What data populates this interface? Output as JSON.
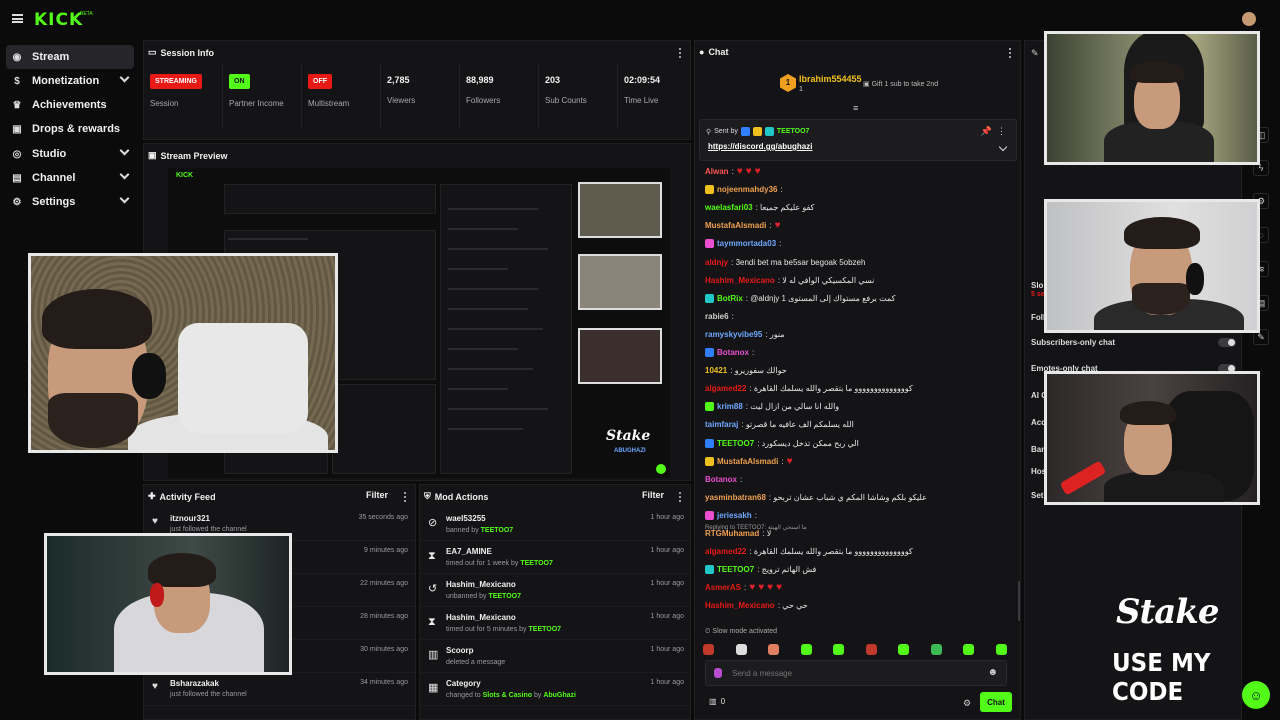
{
  "app": {
    "brand": "KICK",
    "brand_sup": "BETA",
    "accent": "#53fc18"
  },
  "sidebar": {
    "items": [
      {
        "label": "Stream",
        "icon": "broadcast-icon",
        "glyph": "((•))"
      },
      {
        "label": "Monetization",
        "icon": "dollar-icon",
        "glyph": "$"
      },
      {
        "label": "Achievements",
        "icon": "trophy-icon",
        "glyph": "🏆"
      },
      {
        "label": "Drops & rewards",
        "icon": "gift-icon",
        "glyph": "▣"
      },
      {
        "label": "Studio",
        "icon": "studio-icon",
        "glyph": "◎"
      },
      {
        "label": "Channel",
        "icon": "channel-icon",
        "glyph": "▤"
      },
      {
        "label": "Settings",
        "icon": "gear-icon",
        "glyph": "⚙"
      }
    ]
  },
  "session": {
    "title": "Session Info",
    "stats": [
      {
        "value": "STREAMING",
        "label": "Session",
        "badge_color": "#e91916"
      },
      {
        "value": "ON",
        "label": "Partner Income",
        "badge_color": "#53fc18"
      },
      {
        "value": "OFF",
        "label": "Multistream",
        "badge_color": "#e91916"
      },
      {
        "value": "2,785",
        "label": "Viewers"
      },
      {
        "value": "88,989",
        "label": "Followers"
      },
      {
        "value": "203",
        "label": "Sub Counts"
      },
      {
        "value": "02:09:54",
        "label": "Time Live"
      }
    ]
  },
  "preview": {
    "title": "Stream Preview",
    "overlay_brand": "Stake",
    "overlay_sub": "ABUGHAZI"
  },
  "activity": {
    "title": "Activity Feed",
    "filter": "Filter",
    "rows": [
      {
        "name": "itznour321",
        "sub": "just followed the channel",
        "time": "35 seconds ago"
      },
      {
        "name": "",
        "sub": "",
        "time": "9 minutes ago"
      },
      {
        "name": "",
        "sub": "",
        "time": "22 minutes ago"
      },
      {
        "name": "",
        "sub": "",
        "time": "28 minutes ago"
      },
      {
        "name": "",
        "sub": "",
        "time": "30 minutes ago"
      },
      {
        "name": "Bsharazakak",
        "sub": "just followed the channel",
        "time": "34 minutes ago"
      }
    ]
  },
  "mod": {
    "title": "Mod Actions",
    "filter": "Filter",
    "rows": [
      {
        "icon": "ban-icon",
        "glyph": "⊘",
        "name": "wael53255",
        "action": "banned by",
        "by": "TEETOO7",
        "time": "1 hour ago"
      },
      {
        "icon": "hourglass-icon",
        "glyph": "⧗",
        "name": "EA7_AMINE",
        "action": "timed out for 1 week by",
        "by": "TEETOO7",
        "time": "1 hour ago"
      },
      {
        "icon": "undo-icon",
        "glyph": "↺",
        "name": "Hashim_Mexicano",
        "action": "unbanned by",
        "by": "TEETOO7",
        "time": "1 hour ago"
      },
      {
        "icon": "hourglass-icon",
        "glyph": "⧗",
        "name": "Hashim_Mexicano",
        "action": "timed out for 5 minutes by",
        "by": "TEETOO7",
        "time": "1 hour ago"
      },
      {
        "icon": "trash-icon",
        "glyph": "🗑",
        "name": "Scoorp",
        "action": "deleted a message",
        "by": "",
        "time": "1 hour ago"
      },
      {
        "icon": "category-icon",
        "glyph": "▦",
        "name": "Category",
        "action": "changed to",
        "by": "Slots & Casino",
        "action2": "by",
        "by2": "AbuGhazi",
        "time": "1 hour ago"
      }
    ]
  },
  "chat": {
    "title": "Chat",
    "gifter": "Ibrahim554455",
    "gifter_rank": "1",
    "gift_count": "1",
    "gift_text": "Gift 1 sub to take 2nd",
    "pinned_by": "Sent by",
    "pinned_user": "TEETOO7",
    "pinned_link": "https://discord.gg/abughazi",
    "messages": [
      {
        "user": "Alwan",
        "color": "#f55",
        "text": ":",
        "hearts": 3
      },
      {
        "user": "nojeenmahdy36",
        "color": "#f0a050",
        "text": ":"
      },
      {
        "user": "waelasfari03",
        "color": "#53fc18",
        "text": ": كفو عليكم جميعا"
      },
      {
        "user": "MustafaAlsmadi",
        "color": "#f0a050",
        "text": ":",
        "hearts": 1
      },
      {
        "user": "taymmortada03",
        "color": "#6fa8ff",
        "text": ":"
      },
      {
        "user": "aldnjy",
        "color": "#e91916",
        "text": ": 3endi bet ma be5sar begoak 5obzeh"
      },
      {
        "user": "Hashim_Mexicano",
        "color": "#e91916",
        "text": ": نسي المكسيكي الوافي له لا"
      },
      {
        "user": "BotRix",
        "color": "#53fc18",
        "text": ": @aldnjy كمت برفع مستواك إلى المستوى 1"
      },
      {
        "user": "rabie6",
        "color": "#ccc",
        "text": ":"
      },
      {
        "user": "ramyskyvibe95",
        "color": "#6fa8ff",
        "text": ": منور"
      },
      {
        "user": "Botanox",
        "color": "#e94fd0",
        "text": ":"
      },
      {
        "user": "10421",
        "color": "#f0c020",
        "text": ": حوالك سفوريرو"
      },
      {
        "user": "algamed22",
        "color": "#e91916",
        "text": ": كوووووووووووووو ما بتقصر والله يسلمك القاهرة"
      },
      {
        "user": "krim88",
        "color": "#6fa8ff",
        "text": ": والله انا سالي من ازال ليت"
      },
      {
        "user": "taimfaraj",
        "color": "#6fa8ff",
        "text": ": الله يسلمكم الف عافيه ما قصرتو"
      },
      {
        "user": "TEETOO7",
        "color": "#53fc18",
        "text": ": الي ربح ممكن تدخل ديسكورد"
      },
      {
        "user": "MustafaAlsmadi",
        "color": "#f0a050",
        "text": ":",
        "hearts": 1
      },
      {
        "user": "Botanox",
        "color": "#e94fd0",
        "text": ":"
      },
      {
        "user": "yasminbatran68",
        "color": "#f0a050",
        "text": ": عليكو بلكم وشاشا المكم ي شباب عشان تربحو"
      },
      {
        "user": "jeriesakh",
        "color": "#6fa8ff",
        "text": ":"
      },
      {
        "user": "RTGMuhamad",
        "color": "#f0a050",
        "text": ": لا"
      },
      {
        "user": "algamed22",
        "color": "#e91916",
        "text": ": كوووووووووووووو ما بتقصر والله يسلمك القاهرة"
      },
      {
        "user": "TEETOO7",
        "color": "#53fc18",
        "text": ": فش الهاتم ترويج"
      },
      {
        "user": "AsmerAS",
        "color": "#e91916",
        "text": ":",
        "hearts": 4
      },
      {
        "user": "Hashim_Mexicano",
        "color": "#e91916",
        "text": ": حي حي"
      }
    ],
    "reply_to": "Replying to TEETOO7: ما استحي الهيئة",
    "slow_mode": "Slow mode activated",
    "placeholder": "Send a message",
    "points": "0",
    "send_label": "Chat"
  },
  "right_panel": {
    "subscribers_only": "Subscribers-only chat",
    "emotes_only": "Emotes-only chat",
    "partial": [
      "Slo",
      "5 se",
      "Foll",
      "AI C",
      "Acc",
      "Ban",
      "Hos",
      "Set"
    ]
  },
  "overlay": {
    "brand": "Stake",
    "code_text": "USE MY CODE"
  }
}
